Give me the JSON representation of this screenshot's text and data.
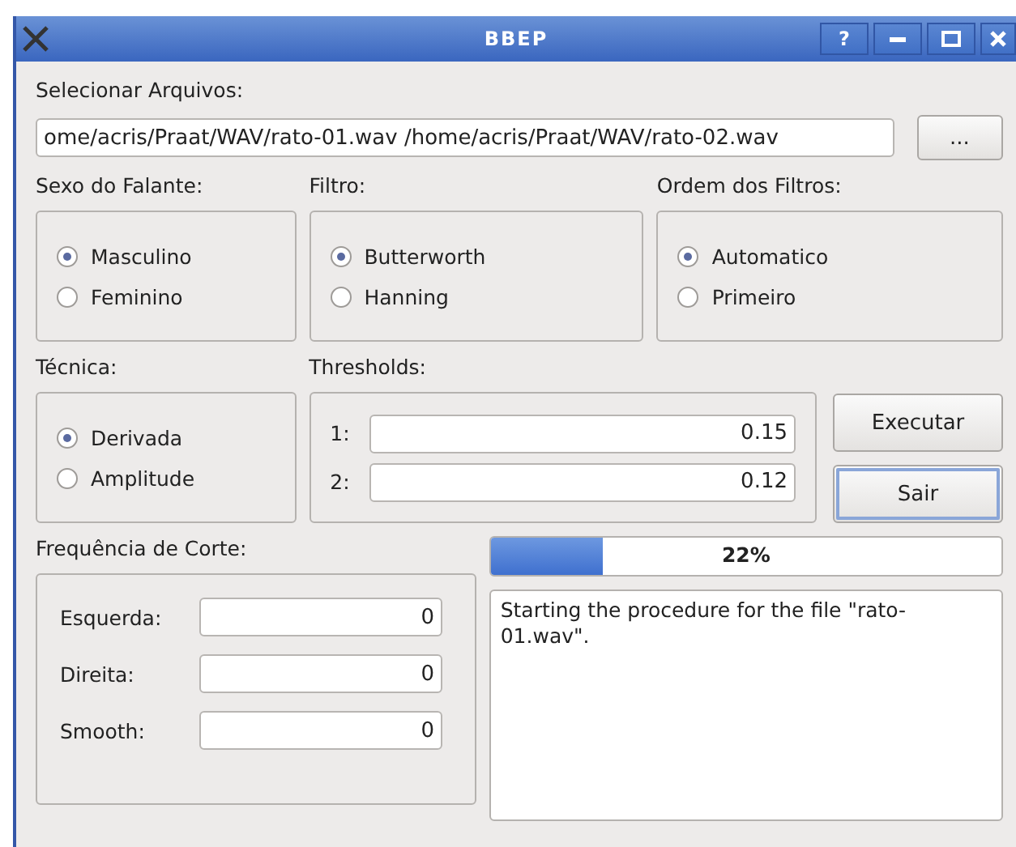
{
  "window": {
    "title": "BBEP",
    "help_button": "?"
  },
  "files": {
    "label": "Selecionar Arquivos:",
    "value": "ome/acris/Praat/WAV/rato-01.wav /home/acris/Praat/WAV/rato-02.wav",
    "browse_button": "..."
  },
  "top_groups": [
    {
      "label": "Sexo do Falante:",
      "options": [
        {
          "label": "Masculino",
          "selected": true
        },
        {
          "label": "Feminino",
          "selected": false
        }
      ]
    },
    {
      "label": "Filtro:",
      "options": [
        {
          "label": "Butterworth",
          "selected": true
        },
        {
          "label": "Hanning",
          "selected": false
        }
      ]
    },
    {
      "label": "Ordem dos Filtros:",
      "options": [
        {
          "label": "Automatico",
          "selected": true
        },
        {
          "label": "Primeiro",
          "selected": false
        }
      ]
    }
  ],
  "tecnica": {
    "label": "Técnica:",
    "options": [
      {
        "label": "Derivada",
        "selected": true
      },
      {
        "label": "Amplitude",
        "selected": false
      }
    ]
  },
  "thresholds": {
    "label": "Thresholds:",
    "fields": [
      {
        "label": "1:",
        "value": "0.15"
      },
      {
        "label": "2:",
        "value": "0.12"
      }
    ]
  },
  "buttons": [
    {
      "label": "Executar",
      "focused": false
    },
    {
      "label": "Sair",
      "focused": true
    }
  ],
  "cutoff": {
    "label": "Frequência de Corte:",
    "fields": [
      {
        "label": "Esquerda:",
        "value": "0"
      },
      {
        "label": "Direita:",
        "value": "0"
      },
      {
        "label": "Smooth:",
        "value": "0"
      }
    ]
  },
  "progress": {
    "level": 0.22,
    "text": "22%"
  },
  "log": "Starting the procedure for the file \"rato-01.wav\"."
}
